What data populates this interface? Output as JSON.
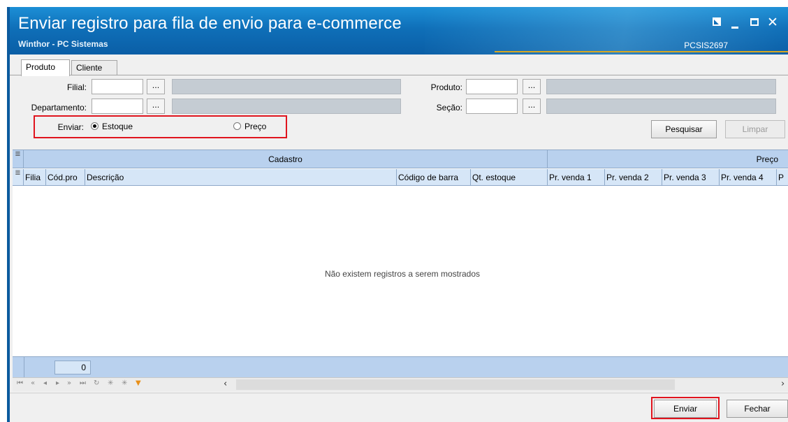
{
  "window": {
    "title": "Enviar registro para fila de envio para e-commerce",
    "subtitle": "Winthor - PC Sistemas",
    "code": "PCSIS2697",
    "controls": {
      "resize": "resize-icon",
      "minimize": "minimize-icon",
      "maximize": "maximize-icon",
      "close": "✕"
    }
  },
  "tabs": [
    {
      "label": "Produto",
      "active": true
    },
    {
      "label": "Cliente",
      "active": false
    }
  ],
  "filters": {
    "filial_label": "Filial:",
    "departamento_label": "Departamento:",
    "produto_label": "Produto:",
    "secao_label": "Seção:",
    "browse": "..."
  },
  "enviar": {
    "label": "Enviar:",
    "options": [
      {
        "label": "Estoque",
        "selected": true
      },
      {
        "label": "Preço",
        "selected": false
      }
    ]
  },
  "actions": {
    "pesquisar": "Pesquisar",
    "limpar": "Limpar",
    "enviar": "Enviar",
    "fechar": "Fechar"
  },
  "grid": {
    "bands": [
      "Cadastro",
      "Preço"
    ],
    "columns": [
      "Filia",
      "Cód.pro",
      "Descrição",
      "Código de barra",
      "Qt. estoque",
      "Pr. venda 1",
      "Pr. venda 2",
      "Pr. venda 3",
      "Pr. venda 4",
      "P"
    ],
    "empty_message": "Não existem registros a serem mostrados",
    "record_count": "0"
  },
  "navigator": {
    "icons": [
      "first-icon",
      "prev-page-icon",
      "prev-icon",
      "next-icon",
      "next-page-icon",
      "last-icon",
      "refresh-icon",
      "insert-icon",
      "multi-insert-icon",
      "filter-icon"
    ]
  },
  "colors": {
    "title_bar": "#0f6fb8",
    "band": "#b9d1ee",
    "column_header": "#d6e6f7",
    "highlight": "#e0141e",
    "accent_line": "#d9a720"
  }
}
